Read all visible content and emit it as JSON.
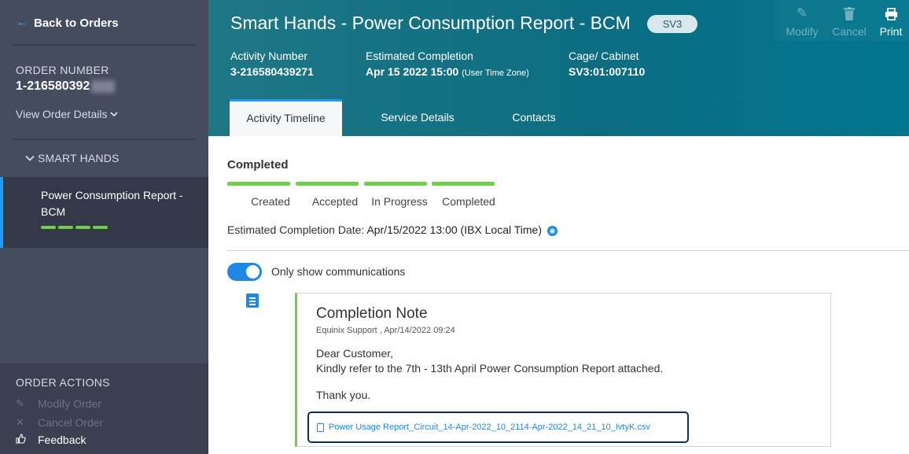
{
  "sidebar": {
    "back_label": "Back to Orders",
    "order_number_label": "ORDER NUMBER",
    "order_number_value": "1-216580392",
    "view_order_details": "View Order Details",
    "section_heading": "SMART HANDS",
    "active_item_label": "Power Consumption Report - BCM",
    "order_actions_heading": "ORDER ACTIONS",
    "actions": [
      {
        "label": "Modify Order",
        "icon": "pencil-icon",
        "enabled": false
      },
      {
        "label": "Cancel Order",
        "icon": "close-icon",
        "enabled": false
      },
      {
        "label": "Feedback",
        "icon": "thumbs-up-icon",
        "enabled": true
      }
    ]
  },
  "header": {
    "title": "Smart Hands - Power Consumption Report - BCM",
    "badge": "SV3",
    "fields": [
      {
        "label": "Activity Number",
        "value": "3-216580439271",
        "note": ""
      },
      {
        "label": "Estimated Completion",
        "value": "Apr 15 2022 15:00",
        "note": "(User Time Zone)"
      },
      {
        "label": "Cage/ Cabinet",
        "value": "SV3:01:007110",
        "note": ""
      }
    ],
    "actions": [
      {
        "label": "Modify",
        "icon": "pencil-icon",
        "enabled": false
      },
      {
        "label": "Cancel",
        "icon": "trash-icon",
        "enabled": false
      },
      {
        "label": "Print",
        "icon": "printer-icon",
        "enabled": true
      }
    ],
    "tabs": [
      {
        "label": "Activity Timeline",
        "active": true
      },
      {
        "label": "Service Details",
        "active": false
      },
      {
        "label": "Contacts",
        "active": false
      }
    ]
  },
  "status": {
    "heading": "Completed",
    "stages": [
      "Created",
      "Accepted",
      "In Progress",
      "Completed"
    ],
    "est_label": "Estimated Completion Date:",
    "est_value": "Apr/15/2022 13:00 (IBX Local Time)"
  },
  "filter": {
    "toggle_label": "Only show communications",
    "toggle_on": true
  },
  "note": {
    "title": "Completion Note",
    "meta": "Equinix Support , Apr/14/2022 09:24",
    "greeting": "Dear Customer,",
    "body": "Kindly refer to the 7th - 13th April Power Consumption Report attached.",
    "closing": "Thank you.",
    "attachment": "Power Usage Report_Circuit_14-Apr-2022_10_2114-Apr-2022_14_21_10_IvtyK.csv"
  },
  "colors": {
    "accent": "#1f9bff",
    "success": "#6fcf4a",
    "sidebar": "#454c5e",
    "header": "#0c6d82"
  }
}
